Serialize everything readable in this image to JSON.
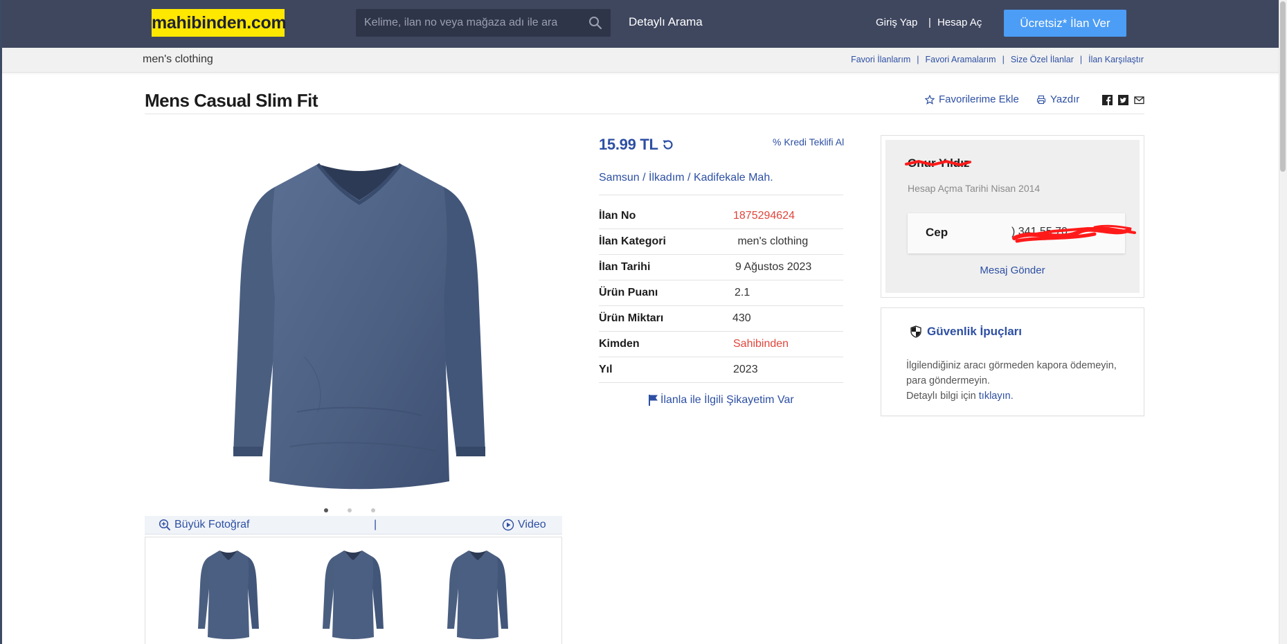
{
  "header": {
    "logo": "mahibinden.com",
    "search_placeholder": "Kelime, ilan no veya mağaza adı ile ara",
    "detailed_search": "Detaylı Arama",
    "login": "Giriş Yap",
    "separator": "|",
    "register": "Hesap Aç",
    "post_button": "Ücretsiz* İlan Ver"
  },
  "subbar": {
    "breadcrumb": "men's clothing",
    "links": [
      "Favori İlanlarım",
      "Favori Aramalarım",
      "Size Özel İlanlar",
      "İlan Karşılaştır"
    ]
  },
  "listing": {
    "title": "Mens Casual Slim Fit",
    "add_favorite": "Favorilerime Ekle",
    "print": "Yazdır",
    "share_icons": [
      "facebook-icon",
      "twitter-icon",
      "email-icon"
    ]
  },
  "gallery": {
    "big_photo": "Büyük Fotoğraf",
    "separator": "|",
    "video": "Video",
    "dots": 3,
    "active_dot": 1,
    "shirt_color": "#4a5f82"
  },
  "info": {
    "price": "15.99 TL",
    "credit": "% Kredi Teklifi Al",
    "location": "Samsun / İlkadım / Kadifekale Mah.",
    "rows": [
      {
        "label": "İlan No",
        "value": "1875294624"
      },
      {
        "label": "İlan Kategori",
        "value": " men's clothing"
      },
      {
        "label": "İlan Tarihi",
        "value": "9 Ağustos 2023"
      },
      {
        "label": "Ürün Puanı",
        "value": "2.1"
      },
      {
        "label": "Ürün Miktarı",
        "value": "430"
      },
      {
        "label": "Kimden",
        "value": "Sahibinden"
      },
      {
        "label": "Yıl",
        "value": "2023"
      }
    ],
    "complaint": "İlanla ile İlgili Şikayetim Var"
  },
  "seller": {
    "name": "Onur Yıldız",
    "since": "Hesap Açma Tarihi Nisan 2014",
    "phone_label": "Cep",
    "phone_visible": ") 341 55 70",
    "message": "Mesaj Gönder"
  },
  "safety": {
    "title": "Güvenlik İpuçları",
    "line1": "İlgilendiğiniz aracı görmeden kapora ödemeyin,",
    "line2": "para göndermeyin.",
    "line3_prefix": "Detaylı bilgi için ",
    "line3_link": "tıklayın."
  },
  "colors": {
    "header_bg": "#3f475f",
    "accent_blue": "#2d4fa3",
    "button_blue": "#4c9df5",
    "logo_yellow": "#ffe800",
    "red": "#e0453b"
  }
}
